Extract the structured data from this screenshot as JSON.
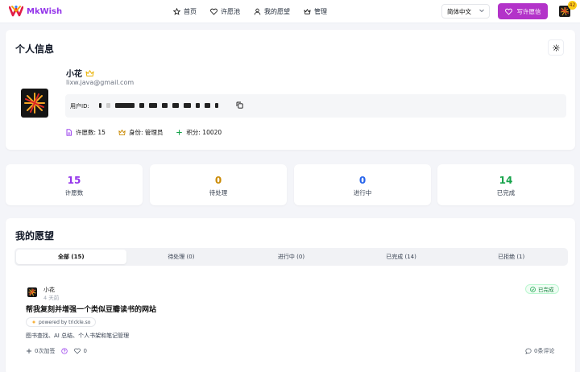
{
  "brand": {
    "name": "MkWish"
  },
  "nav": {
    "links": [
      {
        "label": "首页",
        "icon": "star-icon"
      },
      {
        "label": "许愿池",
        "icon": "heart-icon"
      },
      {
        "label": "我的愿望",
        "icon": "user-icon"
      },
      {
        "label": "管理",
        "icon": "crown-icon"
      }
    ],
    "language": "简体中文",
    "write_button": "写许愿信",
    "notification_count": "42"
  },
  "profile": {
    "section_title": "个人信息",
    "username": "小花",
    "email": "lixw.java@gmail.com",
    "user_id_label": "用户ID:",
    "stats": {
      "wish_count": "许愿数: 15",
      "role": "身份: 管理员",
      "points": "积分: 10020"
    }
  },
  "counters": [
    {
      "value": "15",
      "label": "许愿数",
      "color": "#9333ea"
    },
    {
      "value": "0",
      "label": "待处理",
      "color": "#ca8a04"
    },
    {
      "value": "0",
      "label": "进行中",
      "color": "#2563eb"
    },
    {
      "value": "14",
      "label": "已完成",
      "color": "#16a34a"
    }
  ],
  "wishes": {
    "section_title": "我的愿望",
    "tabs": [
      {
        "label": "全部 (15)",
        "active": true
      },
      {
        "label": "待处理 (0)",
        "active": false
      },
      {
        "label": "进行中 (0)",
        "active": false
      },
      {
        "label": "已完成 (14)",
        "active": false
      },
      {
        "label": "已拒绝 (1)",
        "active": false
      }
    ],
    "item": {
      "user": "小花",
      "time": "4 天前",
      "status": "已完成",
      "title": "帮我复刻并增强一个类似豆瓣读书的网站",
      "powered": "powered by trickle.so",
      "description": "图书查找、AI 总结、个人书架和笔记管理",
      "plus_label": "0次加签",
      "likes": "0",
      "comments": "0条评论"
    }
  }
}
